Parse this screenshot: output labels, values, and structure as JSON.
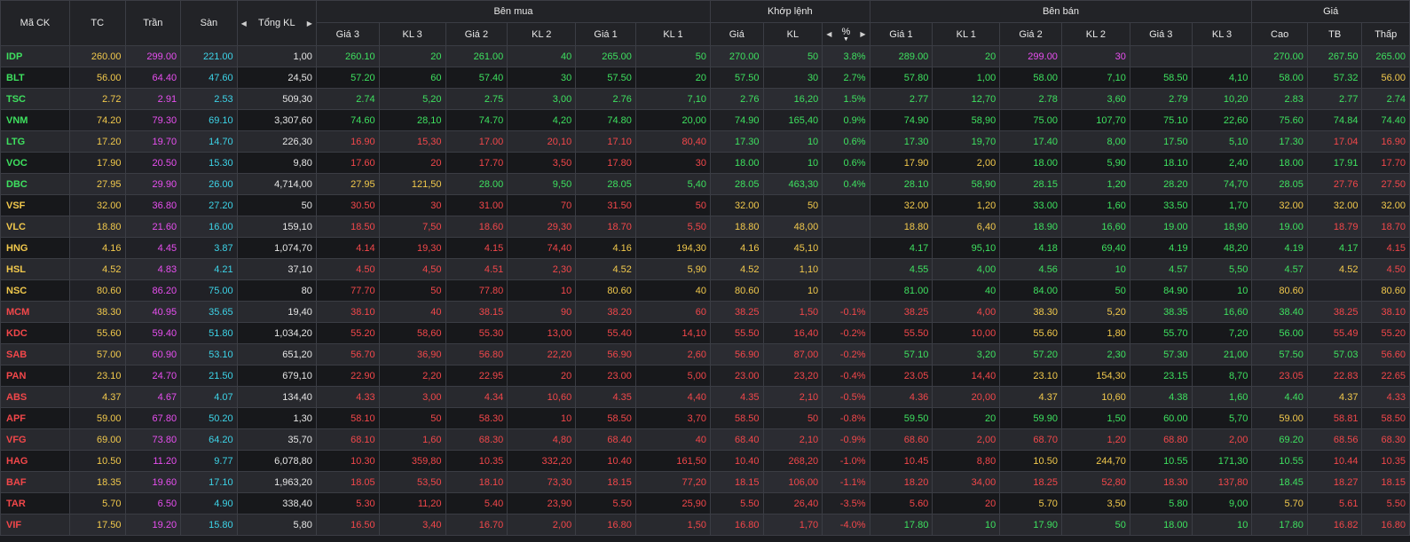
{
  "headers": {
    "symbol": "Mã CK",
    "ref": "TC",
    "ceil": "Trần",
    "floor": "Sàn",
    "total_vol": "Tổng KL",
    "buy_group": "Bên mua",
    "match_group": "Khớp lệnh",
    "sell_group": "Bên bán",
    "price_group": "Giá",
    "bid3": "Giá 3",
    "bidvol3": "KL 3",
    "bid2": "Giá 2",
    "bidvol2": "KL 2",
    "bid1": "Giá 1",
    "bidvol1": "KL 1",
    "match_price": "Giá",
    "match_vol": "KL",
    "match_pct": "%",
    "ask1": "Giá 1",
    "askvol1": "KL 1",
    "ask2": "Giá 2",
    "askvol2": "KL 2",
    "ask3": "Giá 3",
    "askvol3": "KL 3",
    "high": "Cao",
    "avg": "TB",
    "low": "Thấp"
  },
  "colors": {
    "ref": "#f2c94c",
    "ceil": "#e84ff0",
    "floor": "#3dd4e8",
    "up": "#3ee05f",
    "down": "#f2474a",
    "neutral": "#e6e6e6"
  },
  "rows": [
    {
      "sym": "IDP",
      "ref": "260.00",
      "ceil": "299.00",
      "floor": "221.00",
      "tot": "1,00",
      "b3": "260.10",
      "bv3": "20",
      "b2": "261.00",
      "bv2": "40",
      "b1": "265.00",
      "bv1": "50",
      "mp": "270.00",
      "mv": "50",
      "pct": "3.8%",
      "a1": "289.00",
      "av1": "20",
      "a2": "299.00",
      "av2": "30",
      "a3": "",
      "av3": "",
      "hi": "270.00",
      "avg": "267.50",
      "lo": "265.00"
    },
    {
      "sym": "BLT",
      "ref": "56.00",
      "ceil": "64.40",
      "floor": "47.60",
      "tot": "24,50",
      "b3": "57.20",
      "bv3": "60",
      "b2": "57.40",
      "bv2": "30",
      "b1": "57.50",
      "bv1": "20",
      "mp": "57.50",
      "mv": "30",
      "pct": "2.7%",
      "a1": "57.80",
      "av1": "1,00",
      "a2": "58.00",
      "av2": "7,10",
      "a3": "58.50",
      "av3": "4,10",
      "hi": "58.00",
      "avg": "57.32",
      "lo": "56.00"
    },
    {
      "sym": "TSC",
      "ref": "2.72",
      "ceil": "2.91",
      "floor": "2.53",
      "tot": "509,30",
      "b3": "2.74",
      "bv3": "5,20",
      "b2": "2.75",
      "bv2": "3,00",
      "b1": "2.76",
      "bv1": "7,10",
      "mp": "2.76",
      "mv": "16,20",
      "pct": "1.5%",
      "a1": "2.77",
      "av1": "12,70",
      "a2": "2.78",
      "av2": "3,60",
      "a3": "2.79",
      "av3": "10,20",
      "hi": "2.83",
      "avg": "2.77",
      "lo": "2.74"
    },
    {
      "sym": "VNM",
      "ref": "74.20",
      "ceil": "79.30",
      "floor": "69.10",
      "tot": "3,307,60",
      "b3": "74.60",
      "bv3": "28,10",
      "b2": "74.70",
      "bv2": "4,20",
      "b1": "74.80",
      "bv1": "20,00",
      "mp": "74.90",
      "mv": "165,40",
      "pct": "0.9%",
      "a1": "74.90",
      "av1": "58,90",
      "a2": "75.00",
      "av2": "107,70",
      "a3": "75.10",
      "av3": "22,60",
      "hi": "75.60",
      "avg": "74.84",
      "lo": "74.40"
    },
    {
      "sym": "LTG",
      "ref": "17.20",
      "ceil": "19.70",
      "floor": "14.70",
      "tot": "226,30",
      "b3": "16.90",
      "bv3": "15,30",
      "b2": "17.00",
      "bv2": "20,10",
      "b1": "17.10",
      "bv1": "80,40",
      "mp": "17.30",
      "mv": "10",
      "pct": "0.6%",
      "a1": "17.30",
      "av1": "19,70",
      "a2": "17.40",
      "av2": "8,00",
      "a3": "17.50",
      "av3": "5,10",
      "hi": "17.30",
      "avg": "17.04",
      "lo": "16.90"
    },
    {
      "sym": "VOC",
      "ref": "17.90",
      "ceil": "20.50",
      "floor": "15.30",
      "tot": "9,80",
      "b3": "17.60",
      "bv3": "20",
      "b2": "17.70",
      "bv2": "3,50",
      "b1": "17.80",
      "bv1": "30",
      "mp": "18.00",
      "mv": "10",
      "pct": "0.6%",
      "a1": "17.90",
      "av1": "2,00",
      "a2": "18.00",
      "av2": "5,90",
      "a3": "18.10",
      "av3": "2,40",
      "hi": "18.00",
      "avg": "17.91",
      "lo": "17.70"
    },
    {
      "sym": "DBC",
      "ref": "27.95",
      "ceil": "29.90",
      "floor": "26.00",
      "tot": "4,714,00",
      "b3": "27.95",
      "bv3": "121,50",
      "b2": "28.00",
      "bv2": "9,50",
      "b1": "28.05",
      "bv1": "5,40",
      "mp": "28.05",
      "mv": "463,30",
      "pct": "0.4%",
      "a1": "28.10",
      "av1": "58,90",
      "a2": "28.15",
      "av2": "1,20",
      "a3": "28.20",
      "av3": "74,70",
      "hi": "28.05",
      "avg": "27.76",
      "lo": "27.50"
    },
    {
      "sym": "VSF",
      "ref": "32.00",
      "ceil": "36.80",
      "floor": "27.20",
      "tot": "50",
      "b3": "30.50",
      "bv3": "30",
      "b2": "31.00",
      "bv2": "70",
      "b1": "31.50",
      "bv1": "50",
      "mp": "32.00",
      "mv": "50",
      "pct": "",
      "a1": "32.00",
      "av1": "1,20",
      "a2": "33.00",
      "av2": "1,60",
      "a3": "33.50",
      "av3": "1,70",
      "hi": "32.00",
      "avg": "32.00",
      "lo": "32.00"
    },
    {
      "sym": "VLC",
      "ref": "18.80",
      "ceil": "21.60",
      "floor": "16.00",
      "tot": "159,10",
      "b3": "18.50",
      "bv3": "7,50",
      "b2": "18.60",
      "bv2": "29,30",
      "b1": "18.70",
      "bv1": "5,50",
      "mp": "18.80",
      "mv": "48,00",
      "pct": "",
      "a1": "18.80",
      "av1": "6,40",
      "a2": "18.90",
      "av2": "16,60",
      "a3": "19.00",
      "av3": "18,90",
      "hi": "19.00",
      "avg": "18.79",
      "lo": "18.70"
    },
    {
      "sym": "HNG",
      "ref": "4.16",
      "ceil": "4.45",
      "floor": "3.87",
      "tot": "1,074,70",
      "b3": "4.14",
      "bv3": "19,30",
      "b2": "4.15",
      "bv2": "74,40",
      "b1": "4.16",
      "bv1": "194,30",
      "mp": "4.16",
      "mv": "45,10",
      "pct": "",
      "a1": "4.17",
      "av1": "95,10",
      "a2": "4.18",
      "av2": "69,40",
      "a3": "4.19",
      "av3": "48,20",
      "hi": "4.19",
      "avg": "4.17",
      "lo": "4.15"
    },
    {
      "sym": "HSL",
      "ref": "4.52",
      "ceil": "4.83",
      "floor": "4.21",
      "tot": "37,10",
      "b3": "4.50",
      "bv3": "4,50",
      "b2": "4.51",
      "bv2": "2,30",
      "b1": "4.52",
      "bv1": "5,90",
      "mp": "4.52",
      "mv": "1,10",
      "pct": "",
      "a1": "4.55",
      "av1": "4,00",
      "a2": "4.56",
      "av2": "10",
      "a3": "4.57",
      "av3": "5,50",
      "hi": "4.57",
      "avg": "4.52",
      "lo": "4.50"
    },
    {
      "sym": "NSC",
      "ref": "80.60",
      "ceil": "86.20",
      "floor": "75.00",
      "tot": "80",
      "b3": "77.70",
      "bv3": "50",
      "b2": "77.80",
      "bv2": "10",
      "b1": "80.60",
      "bv1": "40",
      "mp": "80.60",
      "mv": "10",
      "pct": "",
      "a1": "81.00",
      "av1": "40",
      "a2": "84.00",
      "av2": "50",
      "a3": "84.90",
      "av3": "10",
      "hi": "80.60",
      "avg": "",
      "lo": "80.60"
    },
    {
      "sym": "MCM",
      "ref": "38.30",
      "ceil": "40.95",
      "floor": "35.65",
      "tot": "19,40",
      "b3": "38.10",
      "bv3": "40",
      "b2": "38.15",
      "bv2": "90",
      "b1": "38.20",
      "bv1": "60",
      "mp": "38.25",
      "mv": "1,50",
      "pct": "-0.1%",
      "a1": "38.25",
      "av1": "4,00",
      "a2": "38.30",
      "av2": "5,20",
      "a3": "38.35",
      "av3": "16,60",
      "hi": "38.40",
      "avg": "38.25",
      "lo": "38.10"
    },
    {
      "sym": "KDC",
      "ref": "55.60",
      "ceil": "59.40",
      "floor": "51.80",
      "tot": "1,034,20",
      "b3": "55.20",
      "bv3": "58,60",
      "b2": "55.30",
      "bv2": "13,00",
      "b1": "55.40",
      "bv1": "14,10",
      "mp": "55.50",
      "mv": "16,40",
      "pct": "-0.2%",
      "a1": "55.50",
      "av1": "10,00",
      "a2": "55.60",
      "av2": "1,80",
      "a3": "55.70",
      "av3": "7,20",
      "hi": "56.00",
      "avg": "55.49",
      "lo": "55.20"
    },
    {
      "sym": "SAB",
      "ref": "57.00",
      "ceil": "60.90",
      "floor": "53.10",
      "tot": "651,20",
      "b3": "56.70",
      "bv3": "36,90",
      "b2": "56.80",
      "bv2": "22,20",
      "b1": "56.90",
      "bv1": "2,60",
      "mp": "56.90",
      "mv": "87,00",
      "pct": "-0.2%",
      "a1": "57.10",
      "av1": "3,20",
      "a2": "57.20",
      "av2": "2,30",
      "a3": "57.30",
      "av3": "21,00",
      "hi": "57.50",
      "avg": "57.03",
      "lo": "56.60"
    },
    {
      "sym": "PAN",
      "ref": "23.10",
      "ceil": "24.70",
      "floor": "21.50",
      "tot": "679,10",
      "b3": "22.90",
      "bv3": "2,20",
      "b2": "22.95",
      "bv2": "20",
      "b1": "23.00",
      "bv1": "5,00",
      "mp": "23.00",
      "mv": "23,20",
      "pct": "-0.4%",
      "a1": "23.05",
      "av1": "14,40",
      "a2": "23.10",
      "av2": "154,30",
      "a3": "23.15",
      "av3": "8,70",
      "hi": "23.05",
      "avg": "22.83",
      "lo": "22.65"
    },
    {
      "sym": "ABS",
      "ref": "4.37",
      "ceil": "4.67",
      "floor": "4.07",
      "tot": "134,40",
      "b3": "4.33",
      "bv3": "3,00",
      "b2": "4.34",
      "bv2": "10,60",
      "b1": "4.35",
      "bv1": "4,40",
      "mp": "4.35",
      "mv": "2,10",
      "pct": "-0.5%",
      "a1": "4.36",
      "av1": "20,00",
      "a2": "4.37",
      "av2": "10,60",
      "a3": "4.38",
      "av3": "1,60",
      "hi": "4.40",
      "avg": "4.37",
      "lo": "4.33"
    },
    {
      "sym": "APF",
      "ref": "59.00",
      "ceil": "67.80",
      "floor": "50.20",
      "tot": "1,30",
      "b3": "58.10",
      "bv3": "50",
      "b2": "58.30",
      "bv2": "10",
      "b1": "58.50",
      "bv1": "3,70",
      "mp": "58.50",
      "mv": "50",
      "pct": "-0.8%",
      "a1": "59.50",
      "av1": "20",
      "a2": "59.90",
      "av2": "1,50",
      "a3": "60.00",
      "av3": "5,70",
      "hi": "59.00",
      "avg": "58.81",
      "lo": "58.50"
    },
    {
      "sym": "VFG",
      "ref": "69.00",
      "ceil": "73.80",
      "floor": "64.20",
      "tot": "35,70",
      "b3": "68.10",
      "bv3": "1,60",
      "b2": "68.30",
      "bv2": "4,80",
      "b1": "68.40",
      "bv1": "40",
      "mp": "68.40",
      "mv": "2,10",
      "pct": "-0.9%",
      "a1": "68.60",
      "av1": "2,00",
      "a2": "68.70",
      "av2": "1,20",
      "a3": "68.80",
      "av3": "2,00",
      "hi": "69.20",
      "avg": "68.56",
      "lo": "68.30"
    },
    {
      "sym": "HAG",
      "ref": "10.50",
      "ceil": "11.20",
      "floor": "9.77",
      "tot": "6,078,80",
      "b3": "10.30",
      "bv3": "359,80",
      "b2": "10.35",
      "bv2": "332,20",
      "b1": "10.40",
      "bv1": "161,50",
      "mp": "10.40",
      "mv": "268,20",
      "pct": "-1.0%",
      "a1": "10.45",
      "av1": "8,80",
      "a2": "10.50",
      "av2": "244,70",
      "a3": "10.55",
      "av3": "171,30",
      "hi": "10.55",
      "avg": "10.44",
      "lo": "10.35"
    },
    {
      "sym": "BAF",
      "ref": "18.35",
      "ceil": "19.60",
      "floor": "17.10",
      "tot": "1,963,20",
      "b3": "18.05",
      "bv3": "53,50",
      "b2": "18.10",
      "bv2": "73,30",
      "b1": "18.15",
      "bv1": "77,20",
      "mp": "18.15",
      "mv": "106,00",
      "pct": "-1.1%",
      "a1": "18.20",
      "av1": "34,00",
      "a2": "18.25",
      "av2": "52,80",
      "a3": "18.30",
      "av3": "137,80",
      "hi": "18.45",
      "avg": "18.27",
      "lo": "18.15"
    },
    {
      "sym": "TAR",
      "ref": "5.70",
      "ceil": "6.50",
      "floor": "4.90",
      "tot": "338,40",
      "b3": "5.30",
      "bv3": "11,20",
      "b2": "5.40",
      "bv2": "23,90",
      "b1": "5.50",
      "bv1": "25,90",
      "mp": "5.50",
      "mv": "26,40",
      "pct": "-3.5%",
      "a1": "5.60",
      "av1": "20",
      "a2": "5.70",
      "av2": "3,50",
      "a3": "5.80",
      "av3": "9,00",
      "hi": "5.70",
      "avg": "5.61",
      "lo": "5.50"
    },
    {
      "sym": "VIF",
      "ref": "17.50",
      "ceil": "19.20",
      "floor": "15.80",
      "tot": "5,80",
      "b3": "16.50",
      "bv3": "3,40",
      "b2": "16.70",
      "bv2": "2,00",
      "b1": "16.80",
      "bv1": "1,50",
      "mp": "16.80",
      "mv": "1,70",
      "pct": "-4.0%",
      "a1": "17.80",
      "av1": "10",
      "a2": "17.90",
      "av2": "50",
      "a3": "18.00",
      "av3": "10",
      "hi": "17.80",
      "avg": "16.82",
      "lo": "16.80"
    }
  ]
}
